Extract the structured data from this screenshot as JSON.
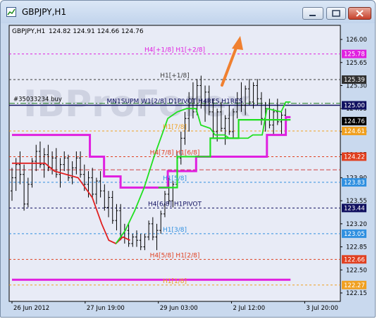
{
  "window": {
    "title": "GBPJPY,H1",
    "minimize_glyph": "–",
    "maximize_glyph": "□",
    "close_glyph": "✕"
  },
  "chart_header": {
    "symbol": "GBPJPY,H1",
    "ohlc": "124.82 124.91 124.66 124.76"
  },
  "chart_data": {
    "type": "line",
    "title": "",
    "ylim": [
      122.15,
      126.15
    ],
    "y_ticks": [
      "126.00",
      "125.65",
      "125.30",
      "124.95",
      "124.60",
      "124.25",
      "123.90",
      "123.55",
      "123.20",
      "122.85",
      "122.50",
      "122.15"
    ],
    "x_tick_labels": [
      "26 Jun 2012",
      "27 Jun 19:00",
      "29 Jun 03:00",
      "2 Jul 12:00",
      "3 Jul 20:00"
    ],
    "x_tick_bars": [
      0,
      31,
      62,
      93,
      124
    ],
    "levels": [
      {
        "label": "H4[+1/8] H1[+2/8]",
        "value": 125.78,
        "color": "#e020e0",
        "label_color": "#e020e0",
        "tag": "125.78",
        "tag_bg": "#e020e0",
        "tag_fg": "#ffffff"
      },
      {
        "label": "H1[+1/8]",
        "value": 125.39,
        "color": "#3a3a3a",
        "label_color": "#3a3a3a",
        "tag": "125.39",
        "tag_bg": "#303030",
        "tag_fg": "#ffffff"
      },
      {
        "label": "MN1SUPM W1[2/8] D1PIVOT H4RES H1RES",
        "value": 125.0,
        "color": "#101060",
        "label_color": "#101060",
        "tag": "125.00",
        "tag_bg": "#101060",
        "tag_fg": "#ffffff",
        "solid": true
      },
      {
        "label": "H1[7/8]",
        "value": 124.61,
        "color": "#f0a020",
        "label_color": "#f0a020",
        "tag": "124.61",
        "tag_bg": "#f0a020",
        "tag_fg": "#ffffff"
      },
      {
        "label": "H4[7/8] H1[6/8]",
        "value": 124.22,
        "color": "#e04020",
        "label_color": "#e04020",
        "tag": "124.22",
        "tag_bg": "#e04020",
        "tag_fg": "#ffffff"
      },
      {
        "label": "H1[5/8]",
        "value": 123.83,
        "color": "#3090e0",
        "label_color": "#3090e0",
        "tag": "123.83",
        "tag_bg": "#3090e0",
        "tag_fg": "#ffffff"
      },
      {
        "label": "H4[6/8] H1PIVOT",
        "value": 123.44,
        "color": "#101060",
        "label_color": "#101060",
        "tag": "123.44",
        "tag_bg": "#101060",
        "tag_fg": "#ffffff"
      },
      {
        "label": "H1[3/8]",
        "value": 123.05,
        "color": "#3090e0",
        "label_color": "#3090e0",
        "tag": "123.05",
        "tag_bg": "#3090e0",
        "tag_fg": "#ffffff"
      },
      {
        "label": "H4[5/8] H1[2/8]",
        "value": 122.66,
        "color": "#e04020",
        "label_color": "#e04020",
        "tag": "122.66",
        "tag_bg": "#e04020",
        "tag_fg": "#ffffff"
      },
      {
        "label": "H1[1/8]",
        "value": 122.27,
        "color": "#f0a020",
        "label_color": "#f0a020",
        "tag": "122.27",
        "tag_bg": "#f0a020",
        "tag_fg": "#ffffff"
      }
    ],
    "current_price": {
      "value": 124.76,
      "tag": "124.76",
      "bg": "#000000",
      "fg": "#ffffff"
    },
    "order_line": {
      "label": "#35033234 buy",
      "value": 125.03,
      "color": "#1a7a1a"
    },
    "extra_hline": {
      "value": 124.02,
      "color": "#d04040"
    },
    "magenta_line": [
      {
        "x": 0,
        "y": 124.55
      },
      {
        "x": 33,
        "y": 124.55
      },
      {
        "x": 33,
        "y": 124.22
      },
      {
        "x": 39,
        "y": 124.22
      },
      {
        "x": 39,
        "y": 123.92
      },
      {
        "x": 46,
        "y": 123.92
      },
      {
        "x": 46,
        "y": 123.75
      },
      {
        "x": 66,
        "y": 123.75
      },
      {
        "x": 66,
        "y": 124.0
      },
      {
        "x": 78,
        "y": 124.0
      },
      {
        "x": 78,
        "y": 124.22
      },
      {
        "x": 108,
        "y": 124.22
      },
      {
        "x": 108,
        "y": 124.55
      },
      {
        "x": 116,
        "y": 124.55
      },
      {
        "x": 116,
        "y": 124.82
      },
      {
        "x": 118,
        "y": 124.82
      }
    ],
    "magenta_bottom": {
      "x0": 0,
      "x1": 118,
      "value": 122.35
    },
    "red_line": [
      {
        "x": 0,
        "y": 124.12
      },
      {
        "x": 14,
        "y": 124.12
      },
      {
        "x": 18,
        "y": 124.0
      },
      {
        "x": 28,
        "y": 123.9
      },
      {
        "x": 34,
        "y": 123.6
      },
      {
        "x": 38,
        "y": 123.2
      },
      {
        "x": 41,
        "y": 122.95
      },
      {
        "x": 44,
        "y": 122.9
      },
      {
        "x": 47,
        "y": 123.0
      },
      {
        "x": 50,
        "y": 122.95
      }
    ],
    "green_line": [
      {
        "x": 44,
        "y": 122.9
      },
      {
        "x": 48,
        "y": 123.1
      },
      {
        "x": 52,
        "y": 123.4
      },
      {
        "x": 56,
        "y": 123.75
      },
      {
        "x": 60,
        "y": 124.2
      },
      {
        "x": 63,
        "y": 124.5
      },
      {
        "x": 66,
        "y": 124.8
      },
      {
        "x": 70,
        "y": 124.9
      },
      {
        "x": 74,
        "y": 124.95
      },
      {
        "x": 78,
        "y": 124.95
      },
      {
        "x": 80,
        "y": 124.7
      },
      {
        "x": 84,
        "y": 124.65
      },
      {
        "x": 86,
        "y": 124.55
      },
      {
        "x": 90,
        "y": 124.55
      },
      {
        "x": 92,
        "y": 124.5
      },
      {
        "x": 100,
        "y": 124.5
      },
      {
        "x": 102,
        "y": 124.55
      },
      {
        "x": 106,
        "y": 124.55
      },
      {
        "x": 108,
        "y": 124.95
      },
      {
        "x": 114,
        "y": 124.9
      },
      {
        "x": 116,
        "y": 125.05
      },
      {
        "x": 118,
        "y": 125.05
      }
    ],
    "green_step": [
      {
        "x": 62,
        "y": 123.75
      },
      {
        "x": 70,
        "y": 123.75
      },
      {
        "x": 70,
        "y": 124.22
      },
      {
        "x": 84,
        "y": 124.22
      },
      {
        "x": 84,
        "y": 124.5
      },
      {
        "x": 96,
        "y": 124.5
      },
      {
        "x": 96,
        "y": 124.78
      },
      {
        "x": 118,
        "y": 124.78
      }
    ],
    "bar_count": 120,
    "bars": [
      {
        "o": 123.7,
        "h": 124.05,
        "l": 123.55,
        "c": 123.9
      },
      {
        "o": 123.9,
        "h": 124.2,
        "l": 123.7,
        "c": 124.1
      },
      {
        "o": 124.1,
        "h": 124.3,
        "l": 123.8,
        "c": 123.95
      },
      {
        "o": 123.95,
        "h": 124.1,
        "l": 123.4,
        "c": 123.5
      },
      {
        "o": 123.5,
        "h": 123.9,
        "l": 123.45,
        "c": 123.8
      },
      {
        "o": 123.8,
        "h": 124.2,
        "l": 123.75,
        "c": 124.15
      },
      {
        "o": 124.15,
        "h": 124.4,
        "l": 124.0,
        "c": 124.3
      },
      {
        "o": 124.3,
        "h": 124.45,
        "l": 124.05,
        "c": 124.1
      },
      {
        "o": 124.1,
        "h": 124.35,
        "l": 123.9,
        "c": 124.25
      },
      {
        "o": 124.25,
        "h": 124.4,
        "l": 124.0,
        "c": 124.05
      },
      {
        "o": 124.05,
        "h": 124.3,
        "l": 123.95,
        "c": 124.2
      },
      {
        "o": 124.2,
        "h": 124.35,
        "l": 123.9,
        "c": 123.95
      },
      {
        "o": 123.95,
        "h": 124.2,
        "l": 123.75,
        "c": 124.1
      },
      {
        "o": 124.1,
        "h": 124.3,
        "l": 124.0,
        "c": 124.2
      },
      {
        "o": 124.2,
        "h": 124.25,
        "l": 123.85,
        "c": 123.9
      },
      {
        "o": 123.9,
        "h": 124.15,
        "l": 123.8,
        "c": 124.05
      },
      {
        "o": 124.05,
        "h": 124.3,
        "l": 123.95,
        "c": 124.2
      },
      {
        "o": 124.2,
        "h": 124.3,
        "l": 123.9,
        "c": 123.95
      },
      {
        "o": 123.95,
        "h": 124.1,
        "l": 123.7,
        "c": 123.8
      },
      {
        "o": 123.8,
        "h": 124.0,
        "l": 123.6,
        "c": 123.9
      },
      {
        "o": 123.9,
        "h": 124.05,
        "l": 123.6,
        "c": 123.65
      },
      {
        "o": 123.65,
        "h": 123.9,
        "l": 123.5,
        "c": 123.85
      },
      {
        "o": 123.85,
        "h": 124.0,
        "l": 123.6,
        "c": 123.7
      },
      {
        "o": 123.7,
        "h": 123.8,
        "l": 123.4,
        "c": 123.45
      },
      {
        "o": 123.45,
        "h": 123.7,
        "l": 123.3,
        "c": 123.6
      },
      {
        "o": 123.6,
        "h": 123.7,
        "l": 123.2,
        "c": 123.25
      },
      {
        "o": 123.25,
        "h": 123.5,
        "l": 123.1,
        "c": 123.4
      },
      {
        "o": 123.4,
        "h": 123.5,
        "l": 122.95,
        "c": 123.0
      },
      {
        "o": 123.0,
        "h": 123.2,
        "l": 122.9,
        "c": 123.1
      },
      {
        "o": 123.1,
        "h": 123.2,
        "l": 122.85,
        "c": 122.9
      },
      {
        "o": 122.9,
        "h": 123.05,
        "l": 122.85,
        "c": 123.0
      },
      {
        "o": 123.0,
        "h": 123.1,
        "l": 122.85,
        "c": 122.95
      },
      {
        "o": 122.95,
        "h": 123.05,
        "l": 122.8,
        "c": 122.85
      },
      {
        "o": 122.85,
        "h": 123.05,
        "l": 122.8,
        "c": 123.0
      },
      {
        "o": 123.0,
        "h": 123.25,
        "l": 122.95,
        "c": 123.2
      },
      {
        "o": 123.2,
        "h": 123.3,
        "l": 122.95,
        "c": 123.0
      },
      {
        "o": 123.0,
        "h": 123.2,
        "l": 122.8,
        "c": 123.1
      },
      {
        "o": 123.1,
        "h": 123.4,
        "l": 123.05,
        "c": 123.35
      },
      {
        "o": 123.35,
        "h": 123.7,
        "l": 123.3,
        "c": 123.65
      },
      {
        "o": 123.65,
        "h": 123.9,
        "l": 123.5,
        "c": 123.55
      },
      {
        "o": 123.55,
        "h": 123.85,
        "l": 123.45,
        "c": 123.8
      },
      {
        "o": 123.8,
        "h": 124.3,
        "l": 123.75,
        "c": 124.2
      },
      {
        "o": 124.2,
        "h": 124.6,
        "l": 124.1,
        "c": 124.5
      },
      {
        "o": 124.5,
        "h": 124.9,
        "l": 124.4,
        "c": 124.8
      },
      {
        "o": 124.8,
        "h": 125.2,
        "l": 124.6,
        "c": 125.1
      },
      {
        "o": 125.1,
        "h": 125.35,
        "l": 124.8,
        "c": 124.9
      },
      {
        "o": 124.9,
        "h": 125.4,
        "l": 124.85,
        "c": 125.3
      },
      {
        "o": 125.3,
        "h": 125.45,
        "l": 124.95,
        "c": 125.0
      },
      {
        "o": 125.0,
        "h": 125.3,
        "l": 124.75,
        "c": 125.2
      },
      {
        "o": 125.2,
        "h": 125.3,
        "l": 124.85,
        "c": 124.9
      },
      {
        "o": 124.9,
        "h": 125.1,
        "l": 124.5,
        "c": 124.6
      },
      {
        "o": 124.6,
        "h": 124.95,
        "l": 124.45,
        "c": 124.9
      },
      {
        "o": 124.9,
        "h": 125.05,
        "l": 124.6,
        "c": 124.65
      },
      {
        "o": 124.65,
        "h": 124.85,
        "l": 124.4,
        "c": 124.8
      },
      {
        "o": 124.8,
        "h": 125.0,
        "l": 124.55,
        "c": 124.6
      },
      {
        "o": 124.6,
        "h": 124.95,
        "l": 124.5,
        "c": 124.9
      },
      {
        "o": 124.9,
        "h": 125.2,
        "l": 124.8,
        "c": 125.1
      },
      {
        "o": 125.1,
        "h": 125.35,
        "l": 124.9,
        "c": 125.0
      },
      {
        "o": 125.0,
        "h": 125.3,
        "l": 124.85,
        "c": 125.25
      },
      {
        "o": 125.25,
        "h": 125.4,
        "l": 125.0,
        "c": 125.05
      },
      {
        "o": 125.05,
        "h": 125.35,
        "l": 124.95,
        "c": 125.3
      },
      {
        "o": 125.3,
        "h": 125.4,
        "l": 125.0,
        "c": 125.1
      },
      {
        "o": 125.1,
        "h": 125.2,
        "l": 124.7,
        "c": 124.8
      },
      {
        "o": 124.8,
        "h": 125.05,
        "l": 124.6,
        "c": 124.95
      },
      {
        "o": 124.95,
        "h": 125.1,
        "l": 124.65,
        "c": 124.7
      },
      {
        "o": 124.7,
        "h": 124.95,
        "l": 124.55,
        "c": 124.9
      },
      {
        "o": 124.9,
        "h": 125.1,
        "l": 124.7,
        "c": 124.75
      },
      {
        "o": 124.75,
        "h": 124.9,
        "l": 124.55,
        "c": 124.85
      },
      {
        "o": 124.85,
        "h": 124.95,
        "l": 124.6,
        "c": 124.76
      }
    ]
  }
}
